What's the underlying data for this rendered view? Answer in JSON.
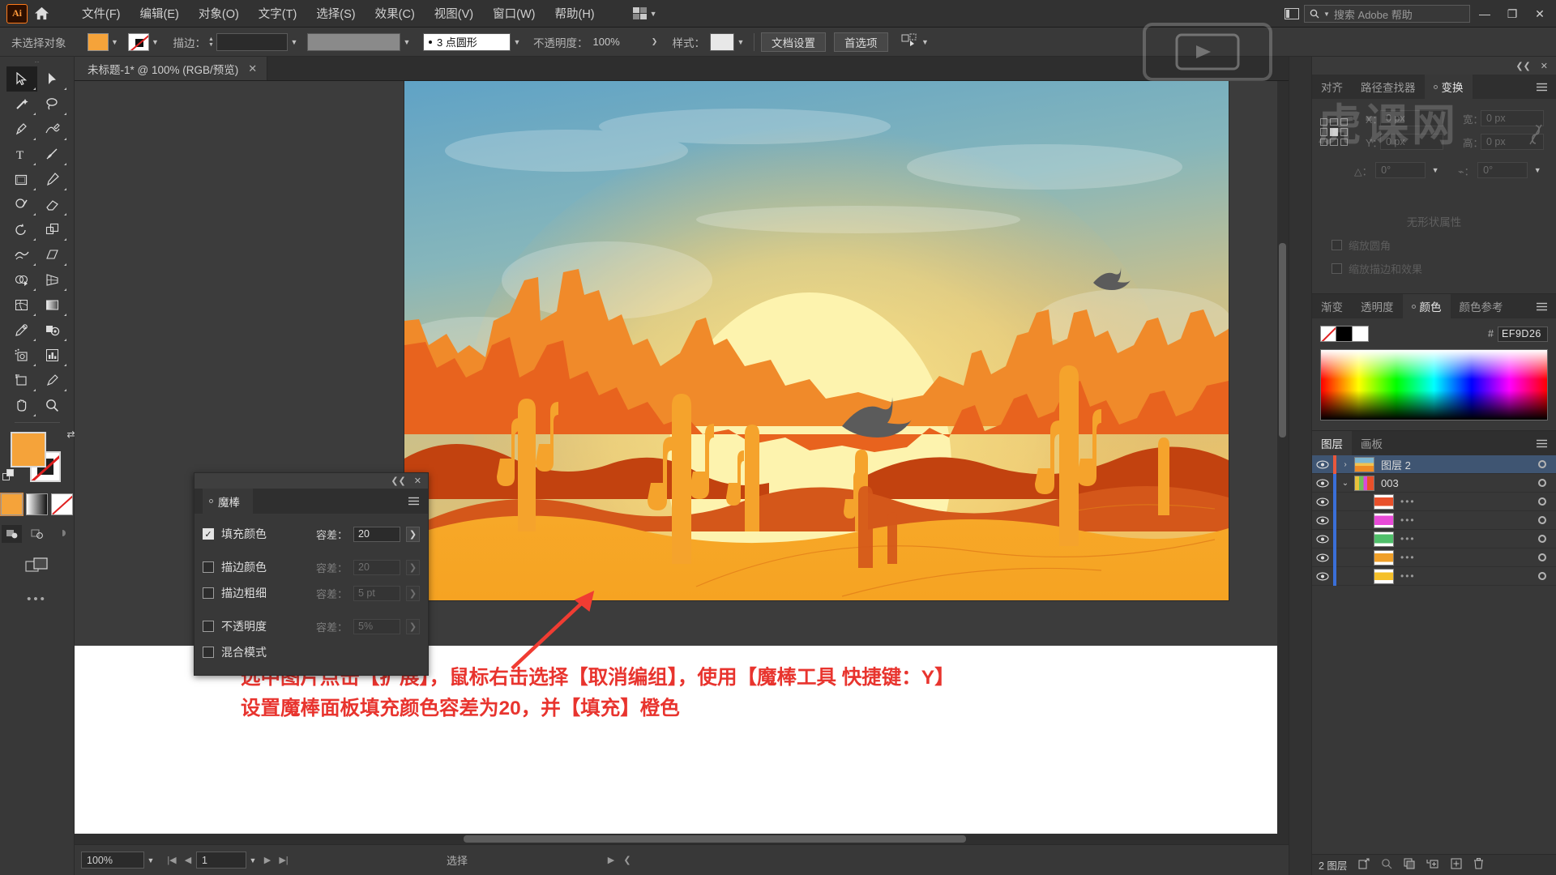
{
  "app": {
    "logo": "Ai",
    "home_icon": "home-icon"
  },
  "menubar": {
    "items": [
      {
        "label": "文件(F)"
      },
      {
        "label": "编辑(E)"
      },
      {
        "label": "对象(O)"
      },
      {
        "label": "文字(T)"
      },
      {
        "label": "选择(S)"
      },
      {
        "label": "效果(C)"
      },
      {
        "label": "视图(V)"
      },
      {
        "label": "窗口(W)"
      },
      {
        "label": "帮助(H)"
      }
    ],
    "search_placeholder": "搜索 Adobe 帮助",
    "minimize": "—",
    "maximize": "❐",
    "close": "✕"
  },
  "controlbar": {
    "selection_status": "未选择对象",
    "stroke_label": "描边：",
    "stroke_weight": "",
    "brush_profile": "3 点圆形",
    "opacity_label": "不透明度：",
    "opacity_value": "100%",
    "style_label": "样式：",
    "doc_setup_button": "文档设置",
    "preferences_button": "首选项",
    "fill_color": "#F5A33A",
    "stroke_color": "none"
  },
  "document": {
    "tab_title": "未标题-1* @ 100% (RGB/预览)",
    "close_icon": "✕"
  },
  "magic_wand_panel": {
    "title": "魔棒",
    "rows": [
      {
        "label": "填充颜色",
        "checked": true,
        "tol_label": "容差：",
        "tol_value": "20",
        "enabled": true
      },
      {
        "label": "描边颜色",
        "checked": false,
        "tol_label": "容差：",
        "tol_value": "20",
        "enabled": false
      },
      {
        "label": "描边粗细",
        "checked": false,
        "tol_label": "容差：",
        "tol_value": "5 pt",
        "enabled": false
      },
      {
        "label": "不透明度",
        "checked": false,
        "tol_label": "容差：",
        "tol_value": "5%",
        "enabled": false
      },
      {
        "label": "混合模式",
        "checked": false,
        "tol_label": "",
        "tol_value": "",
        "enabled": false
      }
    ]
  },
  "transform_panel": {
    "tabs": [
      {
        "label": "对齐",
        "active": false
      },
      {
        "label": "路径查找器",
        "active": false
      },
      {
        "label": "变换",
        "active": true
      }
    ],
    "x_label": "X：",
    "x_value": "0 px",
    "y_label": "Y：",
    "y_value": "0 px",
    "w_label": "宽：",
    "w_value": "0 px",
    "h_label": "高：",
    "h_value": "0 px",
    "angle_label": "△：",
    "angle_value": "0°",
    "shear_label": "⌁：",
    "shear_value": "0°",
    "empty_text": "无形状属性",
    "option_scale_corners": "缩放圆角",
    "option_scale_strokes": "缩放描边和效果",
    "lock_icon": "link-broken-icon"
  },
  "color_panel": {
    "tabs": [
      {
        "label": "渐变",
        "active": false
      },
      {
        "label": "透明度",
        "active": false
      },
      {
        "label": "颜色",
        "active": true
      },
      {
        "label": "颜色参考",
        "active": false
      }
    ],
    "hash": "#",
    "hex_value": "EF9D26"
  },
  "layers_panel": {
    "tabs": [
      {
        "label": "图层",
        "active": true
      },
      {
        "label": "画板",
        "active": false
      }
    ],
    "rows": [
      {
        "name": "图层 2",
        "selected": true,
        "indent": 0,
        "twisty": "›",
        "thumb": "artwork",
        "color": "#e8583c",
        "dots": ""
      },
      {
        "name": "003",
        "selected": false,
        "indent": 1,
        "twisty": "⌄",
        "thumb": "group",
        "color": "#3a6fd8",
        "dots": ""
      },
      {
        "name": "",
        "selected": false,
        "indent": 2,
        "twisty": "",
        "thumb": "#e8502a",
        "color": "#3a6fd8",
        "dots": "•••"
      },
      {
        "name": "",
        "selected": false,
        "indent": 2,
        "twisty": "",
        "thumb": "#e84ad8",
        "color": "#3a6fd8",
        "dots": "•••"
      },
      {
        "name": "",
        "selected": false,
        "indent": 2,
        "twisty": "",
        "thumb": "#4fbf6a",
        "color": "#3a6fd8",
        "dots": "•••"
      },
      {
        "name": "",
        "selected": false,
        "indent": 2,
        "twisty": "",
        "thumb": "#f0a029",
        "color": "#3a6fd8",
        "dots": "•••"
      },
      {
        "name": "",
        "selected": false,
        "indent": 2,
        "twisty": "",
        "thumb": "#f5c02a",
        "color": "#3a6fd8",
        "dots": "•••"
      }
    ],
    "footer_count": "2 图层"
  },
  "statusbar": {
    "zoom": "100%",
    "page": "1",
    "mode": "选择"
  },
  "annotation": {
    "line1": "选中图片点击【扩展】，鼠标右击选择【取消编组】，使用【魔棒工具 快捷键：Y】",
    "line2": "设置魔棒面板填充颜色容差为20，并【填充】橙色",
    "color": "#E8342E"
  },
  "artwork": {
    "description": "沙漠日落插画",
    "sky_top": "#6fa8c4",
    "sky_mid": "#9fbfa8",
    "sun": "#fdf2b0",
    "sand": "#f6a227",
    "mesa_dark": "#c94a16",
    "mesa_mid": "#e8621c",
    "cactus": "#f5a32c"
  },
  "watermark": {
    "text": "虎课网"
  }
}
